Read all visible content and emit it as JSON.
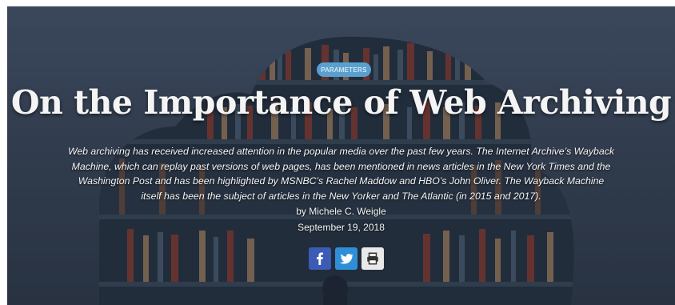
{
  "hero": {
    "tag": "PARAMETERS",
    "title": "On the Importance of Web Archiving",
    "summary": "Web archiving has received increased attention in the popular media over the past few years. The Internet Archive’s Wayback Machine, which can replay past versions of web pages, has been mentioned in news articles in the New York Times and the Washington Post and has been highlighted by MSNBC’s Rachel Maddow and HBO’s John Oliver. The Wayback Machine itself has been the subject of articles in the New Yorker and The Atlantic (in 2015 and 2017).",
    "byline": "by Michele C. Weigle",
    "date": "September 19, 2018"
  },
  "share": {
    "icons": [
      "facebook-icon",
      "twitter-icon",
      "print-icon"
    ]
  },
  "colors": {
    "tag_bg": "#5aa0cf",
    "facebook": "#3b5bb5",
    "twitter": "#2e8fd8"
  }
}
